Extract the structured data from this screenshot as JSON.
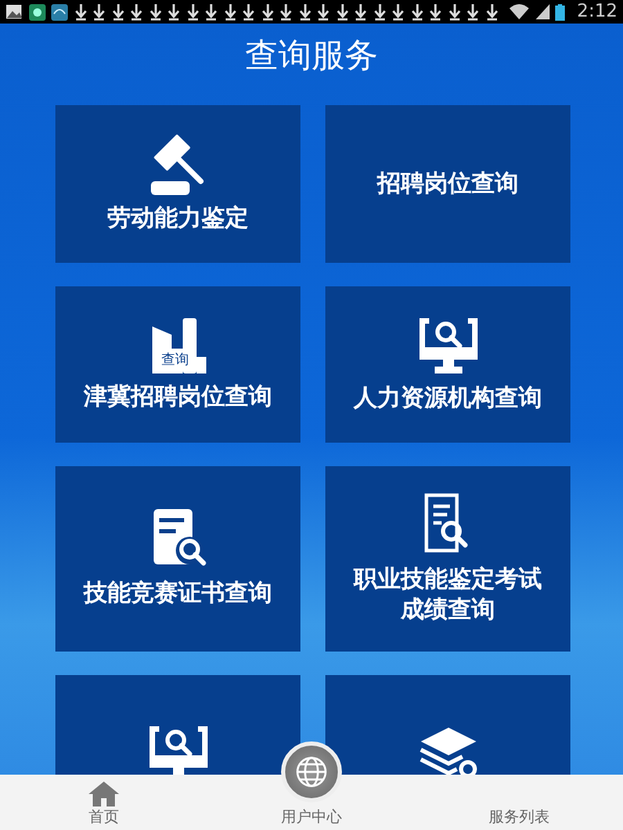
{
  "status_bar": {
    "time": "2:12"
  },
  "title": "查询服务",
  "tiles": [
    {
      "label": "劳动能力鉴定",
      "kind": "gavel"
    },
    {
      "label": "招聘岗位查询",
      "kind": "plain"
    },
    {
      "label": "津冀招聘岗位查询",
      "kind": "buildings",
      "icon_text": "查询"
    },
    {
      "label": "人力资源机构查询",
      "kind": "monitor"
    },
    {
      "label": "技能竞赛证书查询",
      "kind": "card"
    },
    {
      "label": "职业技能鉴定考试成绩查询",
      "kind": "document"
    },
    {
      "kind": "monitor"
    },
    {
      "kind": "layers"
    }
  ],
  "nav": [
    {
      "label": "首页",
      "kind": "home"
    },
    {
      "label": "用户中心",
      "kind": "raised"
    },
    {
      "label": "服务列表",
      "kind": "plain"
    }
  ]
}
